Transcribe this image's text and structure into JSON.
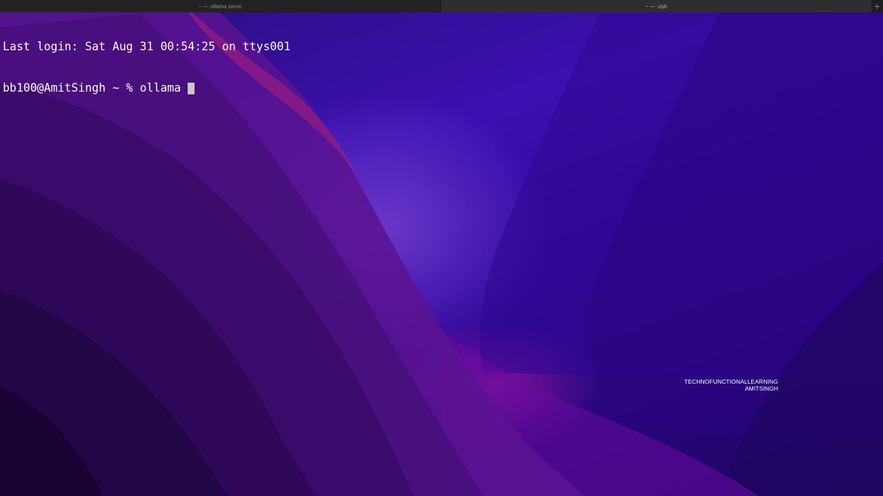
{
  "tabs": [
    {
      "label": "~ — ollama serve",
      "active": false
    },
    {
      "label": "~ — -zsh",
      "active": true
    }
  ],
  "new_tab_icon": "plus-icon",
  "terminal": {
    "lines": [
      "Last login: Sat Aug 31 00:54:25 on ttys001",
      "bb100@AmitSingh ~ % ollama"
    ]
  },
  "watermark": {
    "line1": "TECHNOFUNCTIONALLEARNING",
    "line2": "AMITSINGH"
  },
  "colors": {
    "tabbar_bg": "#1e1e1e",
    "terminal_text": "#ffffff",
    "cursor": "#c8c8c8",
    "wallpaper_primary": "#3a10b0",
    "wallpaper_accent": "#be1eaa"
  }
}
